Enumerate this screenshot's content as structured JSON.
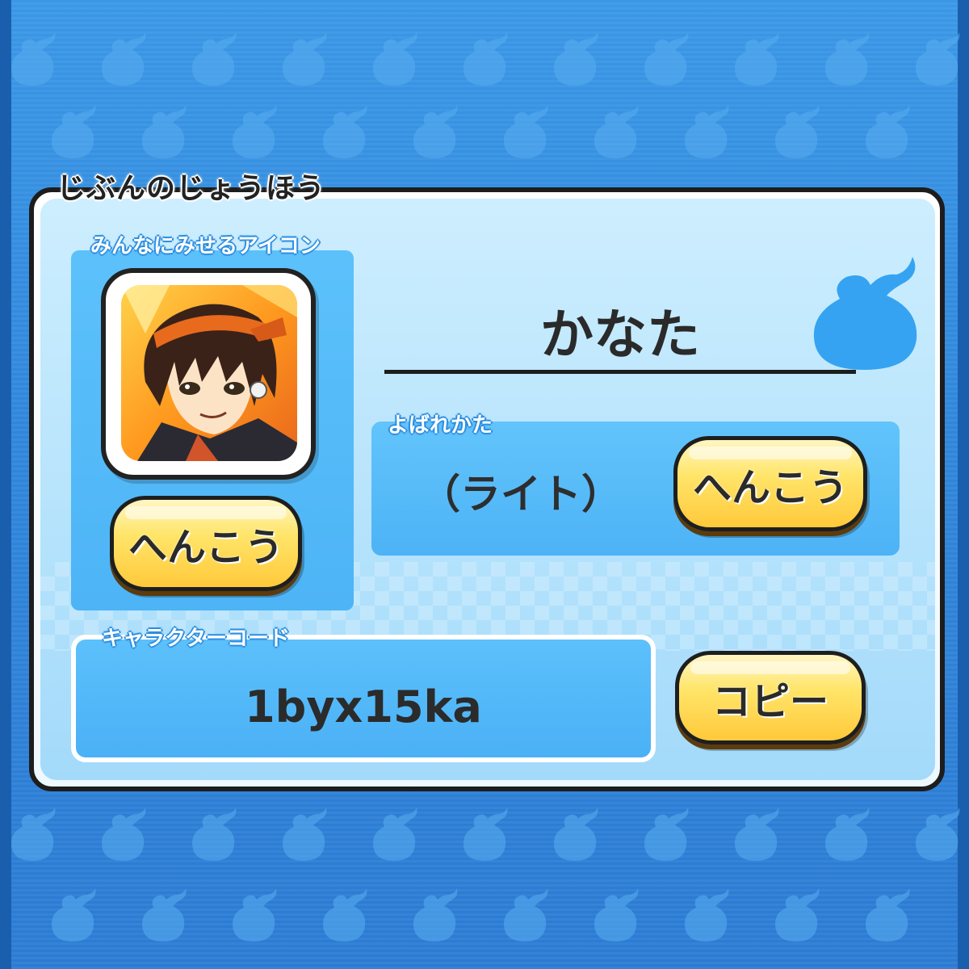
{
  "section_title": "じぶんのじょうほう",
  "icon_section": {
    "label": "みんなにみせるアイコン",
    "change_button": "へんこう"
  },
  "player": {
    "name": "かなた"
  },
  "title_section": {
    "label": "よばれかた",
    "value": "（ライト）",
    "change_button": "へんこう"
  },
  "code_section": {
    "label": "キャラクターコード",
    "value": "1byx15ka",
    "copy_button": "コピー"
  },
  "colors": {
    "background": "#2f86db",
    "button": "#ffd84a",
    "panel_border": "#1d1d1d",
    "inner_box": "#4db4f6"
  }
}
